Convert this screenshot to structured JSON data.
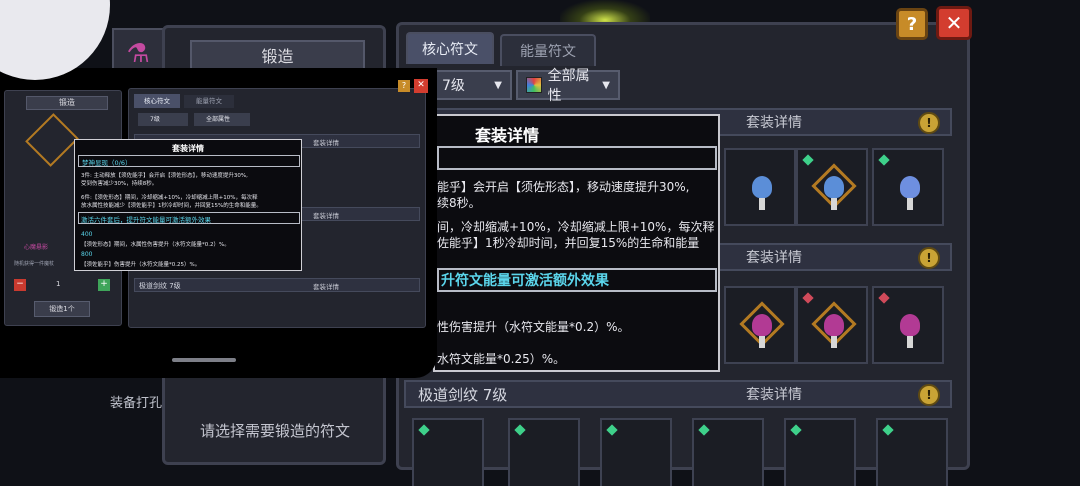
{
  "background": {
    "forge_title": "锻造",
    "forge_hint": "请选择需要锻造的符文",
    "equip_text": "装备打孔",
    "tabs": [
      {
        "label": "核心符文"
      },
      {
        "label": "能量符文"
      }
    ],
    "filter_level": "7级",
    "filter_attr": "全部属性",
    "sections": [
      {
        "title": "",
        "detail": "套装详情"
      },
      {
        "title": "",
        "detail": "套装详情"
      },
      {
        "title": "极道剑纹 7级",
        "detail": "套装详情"
      }
    ],
    "help_label": "?",
    "close_label": "✕"
  },
  "tooltip": {
    "title": "套装详情",
    "lines": [
      "能乎】会开启【须佐形态】，移动速度提升30%,",
      "续8秒。",
      "间，冷却缩减+10%，冷却缩减上限+10%，每次释",
      "佐能乎】1秒冷却时间，并回复15%的生命和能量",
      "升符文能量可激活额外效果",
      "性伤害提升（水符文能量*0.2）%。",
      "水符文能量*0.25）%。"
    ]
  },
  "overlay": {
    "forge_title": "锻造",
    "tabs": [
      {
        "label": "核心符文"
      },
      {
        "label": "能量符文"
      }
    ],
    "filter_level": "7级",
    "filter_attr": "全部属性",
    "section_detail": "套装详情",
    "section3_title": "极道剑纹 7级",
    "quantity": "1",
    "forge_button": "锻造1个",
    "rune_name": "心魔悬影",
    "hint": "随机获得一件魔杖",
    "tooltip": {
      "title": "套装详情",
      "set_name": "梦神显现（0/6）",
      "line1": "3件: 主动释放【须佐能乎】会开启【须佐形态】，移动速度提升30%,",
      "line2": "受到伤害减少30%，持续8秒。",
      "line3": "6件:【须佐形态】期间，冷却缩减+10%，冷却缩减上限+10%，每次释",
      "line4": "放水属性技能减少【须佐能乎】1秒冷却时间，并回复15%的生命和能量。",
      "activate": "激活六件套后，提升符文能量可激活额外效果",
      "energy1": "400",
      "effect1": "【须佐形态】期间，水属性伤害提升（水符文能量*0.2）%。",
      "energy2": "800",
      "effect2": "【须佐能乎】伤害提升（水符文能量*0.25）%。"
    }
  }
}
